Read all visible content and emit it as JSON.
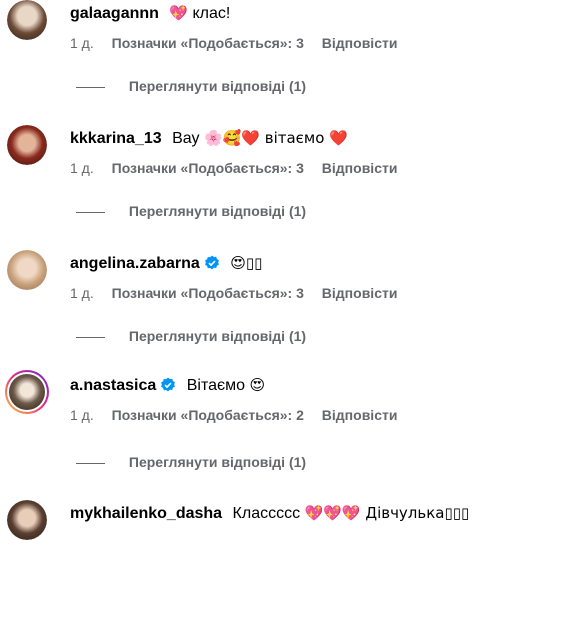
{
  "comments": [
    {
      "username": "galaagannn",
      "text_emoji_before": "💖",
      "text": "клас!",
      "text_emoji_after": "",
      "verified": false,
      "time": "1 д.",
      "likes": "Позначки «Подобається»: 3",
      "reply": "Відповісти",
      "view_replies": "Переглянути відповіді (1)"
    },
    {
      "username": "kkkarina_13",
      "text_emoji_before": "",
      "text": "Вау",
      "text_emoji_after": "🌸🥰❤️ вітаємо ❤️",
      "verified": false,
      "time": "1 д.",
      "likes": "Позначки «Подобається»: 3",
      "reply": "Відповісти",
      "view_replies": "Переглянути відповіді (1)"
    },
    {
      "username": "angelina.zabarna",
      "text_emoji_before": "",
      "text": "",
      "text_emoji_after": "😍▯▯",
      "verified": true,
      "time": "1 д.",
      "likes": "Позначки «Подобається»: 3",
      "reply": "Відповісти",
      "view_replies": "Переглянути відповіді (1)"
    },
    {
      "username": "a.nastasica",
      "text_emoji_before": "",
      "text": "Вітаємо",
      "text_emoji_after": "😍",
      "verified": true,
      "time": "1 д.",
      "likes": "Позначки «Подобається»: 2",
      "reply": "Відповісти",
      "view_replies": "Переглянути відповіді (1)"
    },
    {
      "username": "mykhailenko_dasha",
      "text_emoji_before": "",
      "text": "Классссс",
      "text_emoji_after": "💖💖💖 Дівчулька▯▯▯",
      "verified": false,
      "time": "",
      "likes": "",
      "reply": "",
      "view_replies": ""
    }
  ],
  "colors": {
    "meta_text": "#65676b",
    "verified_badge": "#0095f6",
    "story_ring": "gradient"
  }
}
